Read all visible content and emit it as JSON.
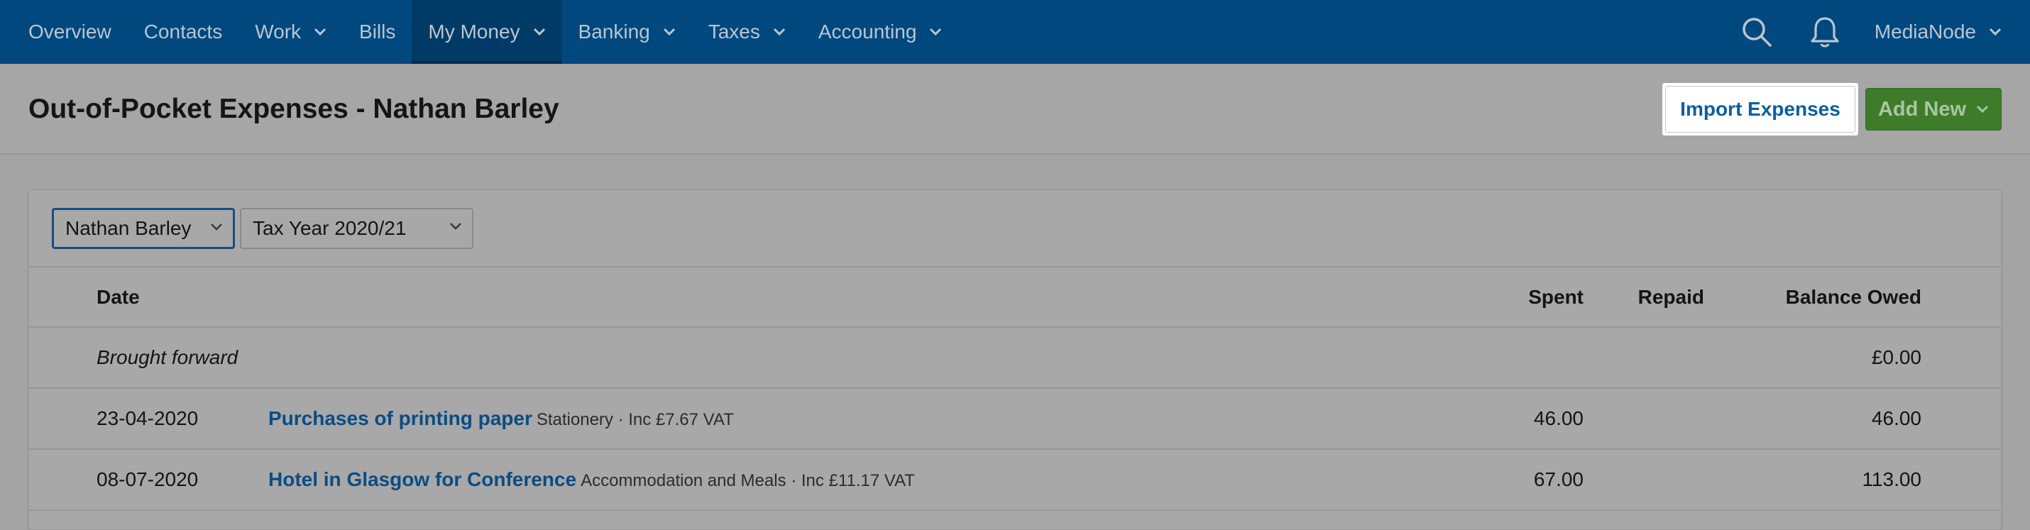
{
  "nav": {
    "items": [
      {
        "label": "Overview",
        "dropdown": false,
        "active": false
      },
      {
        "label": "Contacts",
        "dropdown": false,
        "active": false
      },
      {
        "label": "Work",
        "dropdown": true,
        "active": false
      },
      {
        "label": "Bills",
        "dropdown": false,
        "active": false
      },
      {
        "label": "My Money",
        "dropdown": true,
        "active": true
      },
      {
        "label": "Banking",
        "dropdown": true,
        "active": false
      },
      {
        "label": "Taxes",
        "dropdown": true,
        "active": false
      },
      {
        "label": "Accounting",
        "dropdown": true,
        "active": false
      }
    ],
    "search_icon": "search-icon",
    "notifications_icon": "bell-icon",
    "account_label": "MediaNode"
  },
  "header": {
    "title": "Out-of-Pocket Expenses - Nathan Barley",
    "import_button": "Import Expenses",
    "add_button": "Add New"
  },
  "filters": {
    "person": "Nathan Barley",
    "tax_year": "Tax Year 2020/21"
  },
  "table": {
    "columns": {
      "date": "Date",
      "spent": "Spent",
      "repaid": "Repaid",
      "balance": "Balance Owed"
    },
    "brought_forward": {
      "label": "Brought forward",
      "balance": "£0.00"
    },
    "rows": [
      {
        "date": "23-04-2020",
        "description": "Purchases of printing paper",
        "meta": "Stationery · Inc £7.67 VAT",
        "spent": "46.00",
        "repaid": "",
        "balance": "46.00"
      },
      {
        "date": "08-07-2020",
        "description": "Hotel in Glasgow for Conference",
        "meta": "Accommodation and Meals · Inc £11.17 VAT",
        "spent": "67.00",
        "repaid": "",
        "balance": "113.00"
      }
    ]
  },
  "colors": {
    "nav_bg": "#00487e",
    "link": "#0b4c82",
    "add_button": "#3e7c2a",
    "overlay_bg": "#a4a4a4"
  }
}
